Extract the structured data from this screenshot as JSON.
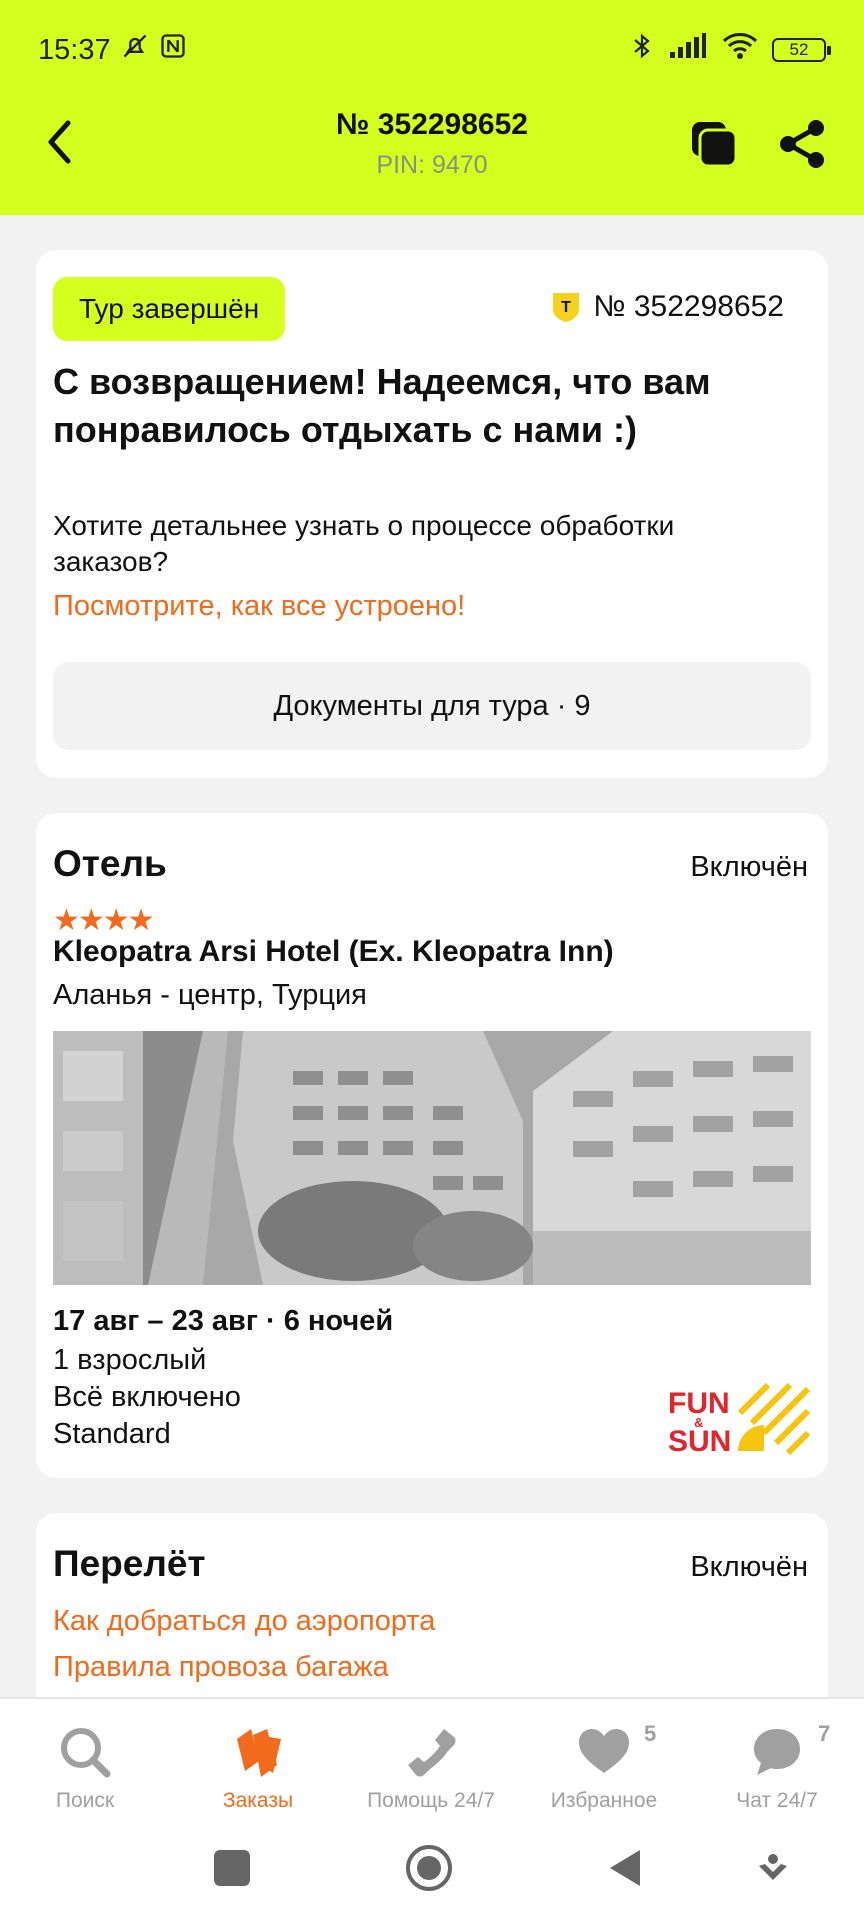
{
  "status": {
    "time": "15:37",
    "battery": "52"
  },
  "header": {
    "title": "№ 352298652",
    "pin": "PIN: 9470"
  },
  "order_card": {
    "badge": "Тур завершён",
    "order_number": "№ 352298652",
    "welcome": "С возвращением! Надеемся, что вам понравилось отдыхать с нами :)",
    "question": "Хотите детальнее узнать о процессе обработки заказов?",
    "link": "Посмотрите, как все устроено!",
    "docs_button": "Документы для тура · 9"
  },
  "hotel_card": {
    "title": "Отель",
    "included": "Включён",
    "stars": "★★★★",
    "name": "Kleopatra Arsi Hotel (Ex. Kleopatra Inn)",
    "location": "Аланья - центр, Турция",
    "dates": "17 авг – 23 авг · 6 ночей",
    "guests": "1 взрослый",
    "meal": "Всё включено",
    "room": "Standard",
    "operator_logo": "FUN & SUN"
  },
  "flight_card": {
    "title": "Перелёт",
    "included": "Включён",
    "link_airport": "Как добраться до аэропорта",
    "link_baggage": "Правила провоза багажа"
  },
  "bottom_nav": {
    "tabs": [
      {
        "label": "Поиск",
        "icon": "search-icon"
      },
      {
        "label": "Заказы",
        "icon": "orders-icon"
      },
      {
        "label": "Помощь 24/7",
        "icon": "phone-icon"
      },
      {
        "label": "Избранное",
        "icon": "heart-icon",
        "count": "5"
      },
      {
        "label": "Чат 24/7",
        "icon": "chat-icon",
        "count": "7"
      }
    ]
  },
  "colors": {
    "accent": "#d4ff1f",
    "link": "#f26a1b",
    "background": "#f2f2f2"
  }
}
